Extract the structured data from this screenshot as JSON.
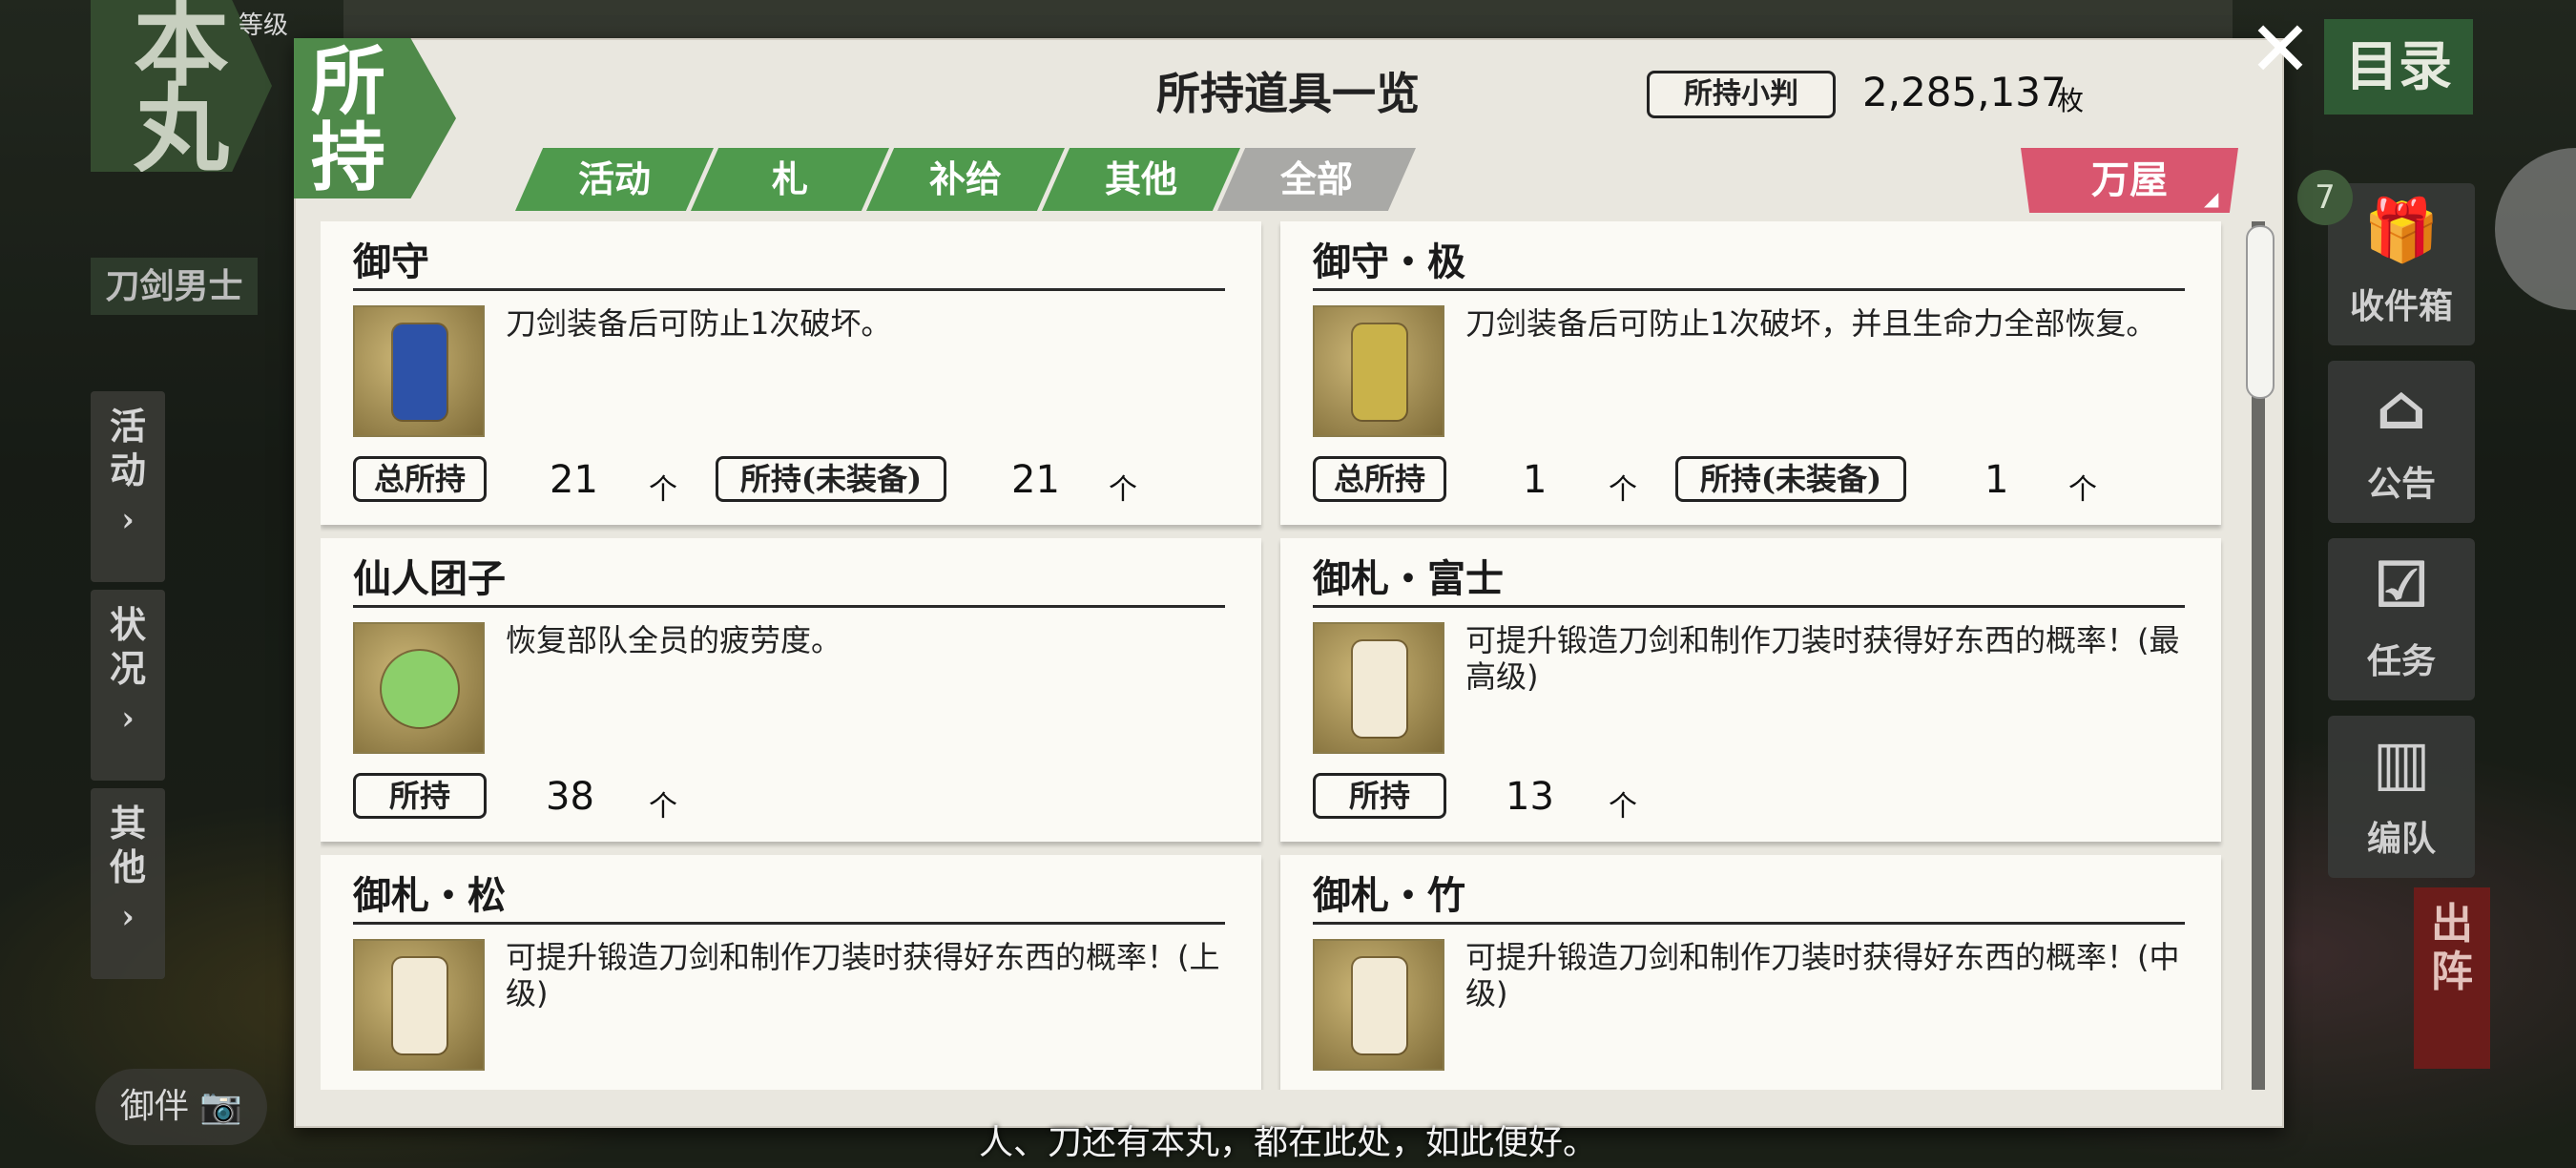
{
  "game_ui": {
    "honmaru": "本丸",
    "level_label": "等级",
    "touken_danshi": "刀剑男士",
    "left_nav": [
      {
        "label": "活动"
      },
      {
        "label": "状况"
      },
      {
        "label": "其他"
      }
    ],
    "chevron": "›",
    "omamori_camera": "御伴",
    "mokuroku": "目录",
    "right_nav": [
      {
        "label": "收件箱",
        "icon": "gift-icon",
        "glyph": "🎁"
      },
      {
        "label": "公告",
        "icon": "house-icon",
        "glyph": "⌂"
      },
      {
        "label": "任务",
        "icon": "checklist-icon",
        "glyph": "☑"
      },
      {
        "label": "编队",
        "icon": "formation-icon",
        "glyph": "▥"
      }
    ],
    "inbox_badge": "7",
    "shutsujin": "出阵",
    "subtitle": "人、刀还有本丸，都在此处，如此便好。"
  },
  "modal": {
    "flag": "所持",
    "title": "所持道具一览",
    "koban_label": "所持小判",
    "koban_value": "2,285,137",
    "koban_unit": "枚",
    "close": "✕",
    "tabs": [
      {
        "label": "活动"
      },
      {
        "label": "札"
      },
      {
        "label": "补给"
      },
      {
        "label": "其他"
      },
      {
        "label": "全部"
      }
    ],
    "yorozuya": "万屋",
    "items": [
      {
        "name": "御守",
        "desc": "刀剑装备后可防止1次破坏。",
        "total_label": "总所持",
        "total": "21",
        "unequipped_label": "所持(未装备)",
        "unequipped": "21",
        "unit": "个",
        "color": "#2d52a8"
      },
      {
        "name": "御守・极",
        "desc": "刀剑装备后可防止1次破坏，并且生命力全部恢复。",
        "total_label": "总所持",
        "total": "1",
        "unequipped_label": "所持(未装备)",
        "unequipped": "1",
        "unit": "个",
        "color": "#c9b24a"
      },
      {
        "name": "仙人团子",
        "desc": "恢复部队全员的疲劳度。",
        "total_label": "所持",
        "total": "38",
        "unit": "个",
        "color": "#8ccf6a"
      },
      {
        "name": "御札・富士",
        "desc": "可提升锻造刀剑和制作刀装时获得好东西的概率！(最高级)",
        "total_label": "所持",
        "total": "13",
        "unit": "个",
        "color": "#f2ead6"
      },
      {
        "name": "御札・松",
        "desc": "可提升锻造刀剑和制作刀装时获得好东西的概率！(上级)",
        "color": "#f2ead6"
      },
      {
        "name": "御札・竹",
        "desc": "可提升锻造刀剑和制作刀装时获得好东西的概率！(中级)",
        "color": "#f2ead6"
      }
    ]
  }
}
